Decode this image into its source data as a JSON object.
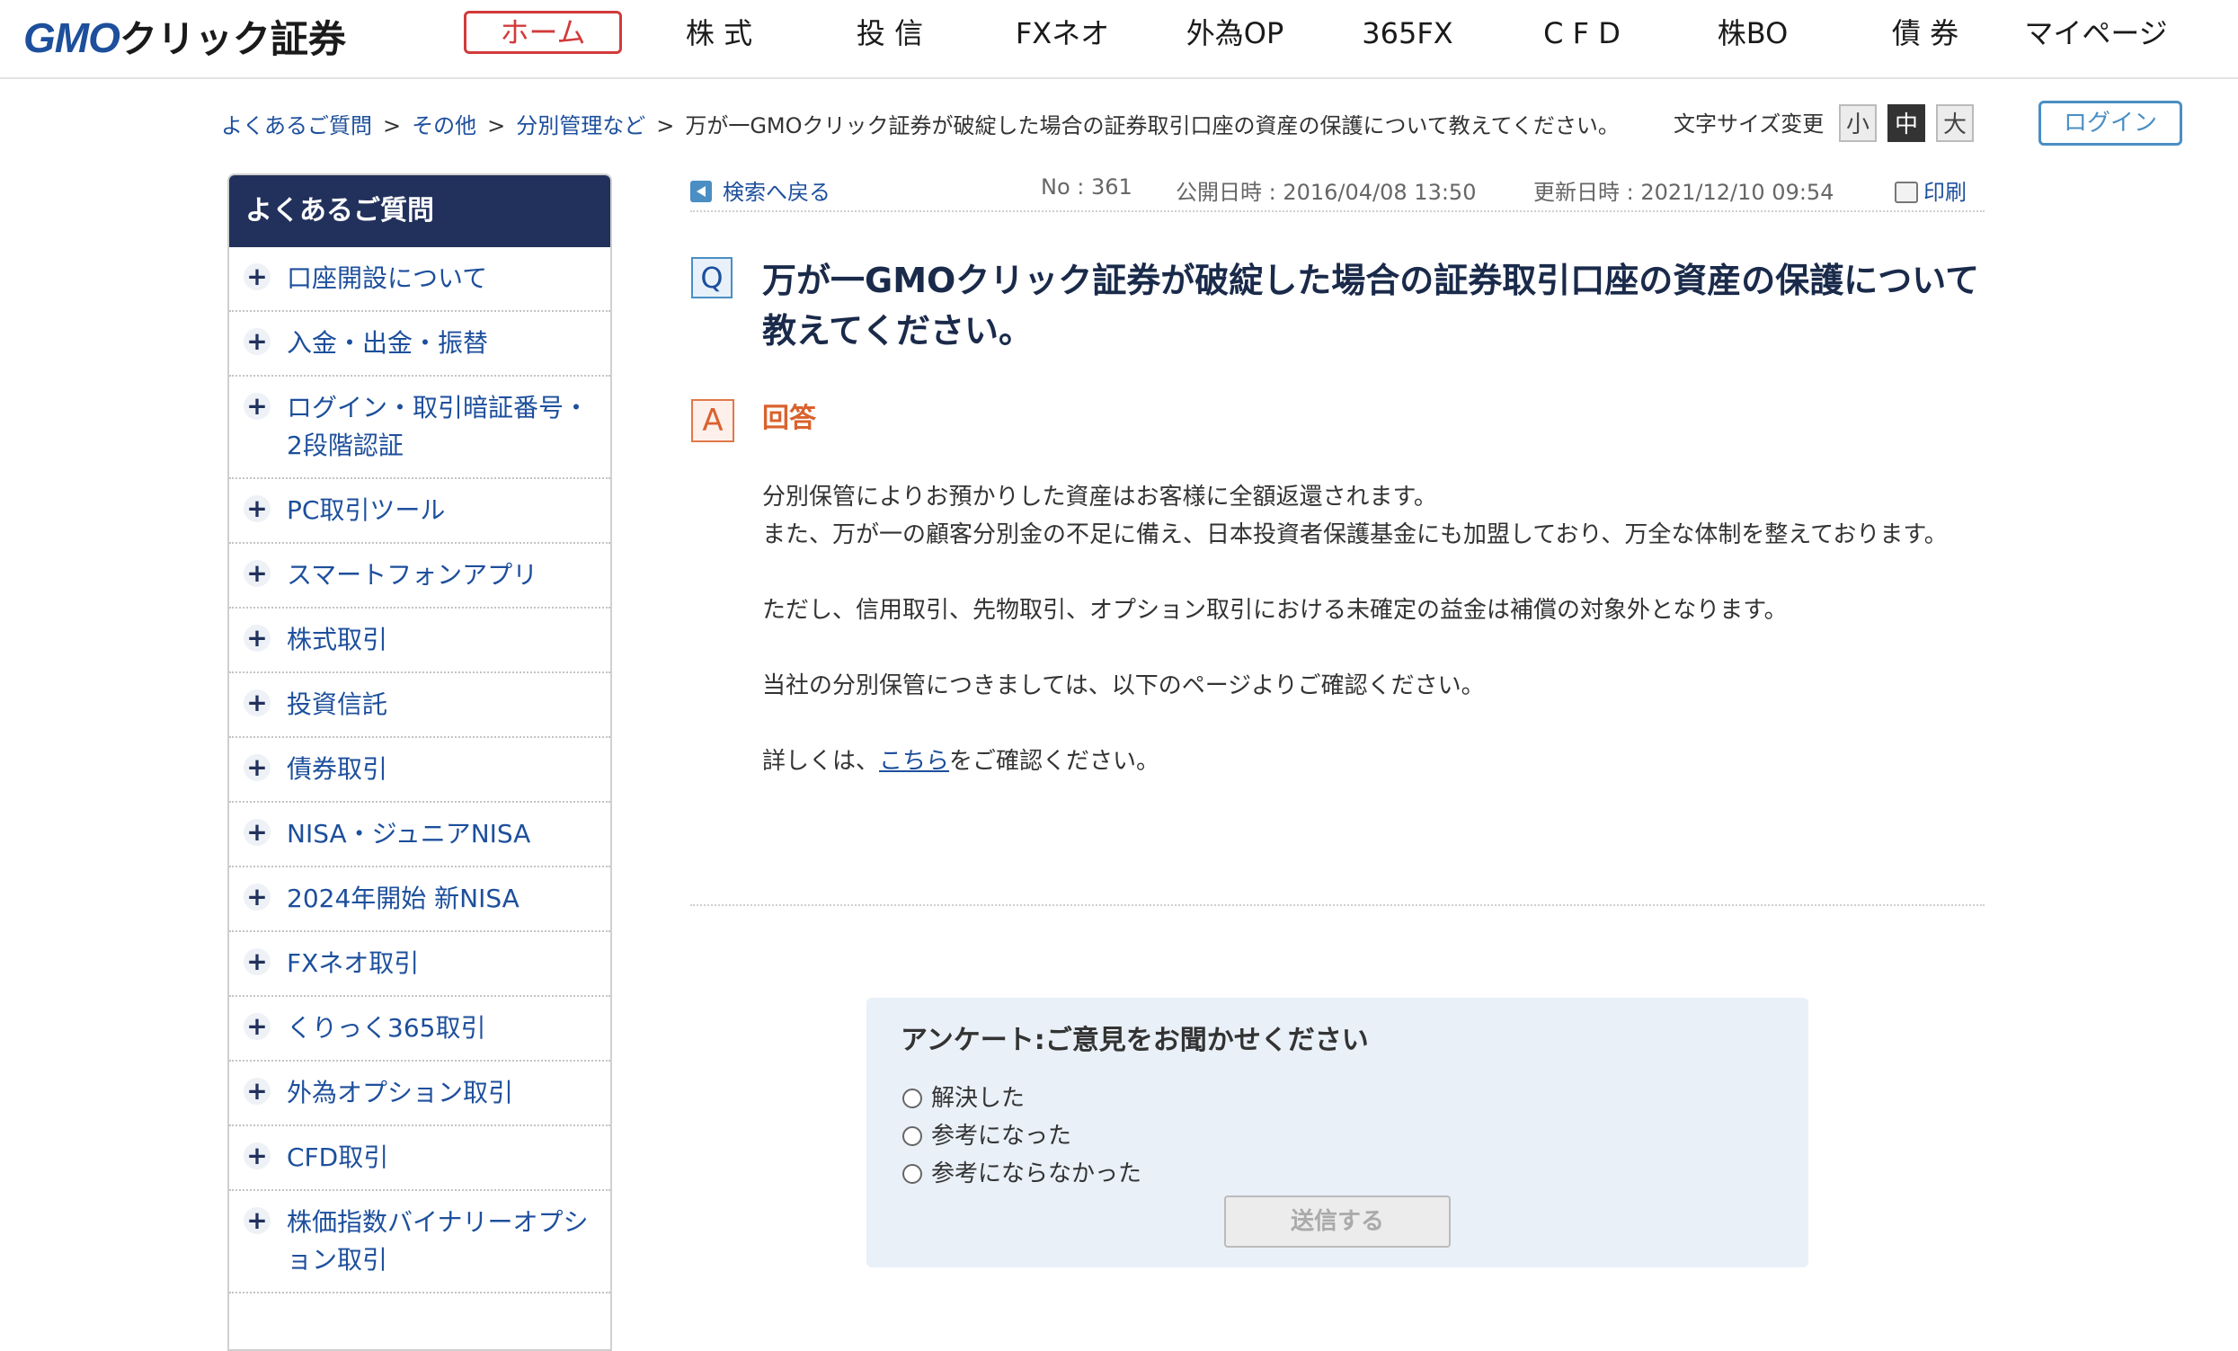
{
  "header": {
    "logo_gmo": "GMO",
    "logo_rest": "クリック証券",
    "nav": [
      "ホーム",
      "株 式",
      "投 信",
      "FXネオ",
      "外為OP",
      "365FX",
      "C F D",
      "株BO",
      "債 券",
      "マイページ"
    ]
  },
  "breadcrumb": {
    "items": [
      "よくあるご質問",
      "その他",
      "分別管理など"
    ],
    "separator": ">",
    "current": "万が一GMOクリック証券が破綻した場合の証券取引口座の資産の保護について教えてください。"
  },
  "font_size": {
    "label": "文字サイズ変更",
    "options": [
      "小",
      "中",
      "大"
    ],
    "selected": "中"
  },
  "login_label": "ログイン",
  "sidebar": {
    "heading": "よくあるご質問",
    "items": [
      "口座開設について",
      "入金・出金・振替",
      "ログイン・取引暗証番号・2段階認証",
      "PC取引ツール",
      "スマートフォンアプリ",
      "株式取引",
      "投資信託",
      "債券取引",
      "NISA・ジュニアNISA",
      "2024年開始 新NISA",
      "FXネオ取引",
      "くりっく365取引",
      "外為オプション取引",
      "CFD取引",
      "株価指数バイナリーオプション取引"
    ]
  },
  "article": {
    "back_label": "検索へ戻る",
    "number": "No : 361",
    "published": "公開日時 : 2016/04/08 13:50",
    "updated": "更新日時 : 2021/12/10 09:54",
    "print_label": "印刷",
    "q_badge": "Q",
    "question": "万が一GMOクリック証券が破綻した場合の証券取引口座の資産の保護について教えてください。",
    "a_badge": "A",
    "answer_label": "回答",
    "answer_line1": "分別保管によりお預かりした資産はお客様に全額返還されます。",
    "answer_line2": "また、万が一の顧客分別金の不足に備え、日本投資者保護基金にも加盟しており、万全な体制を整えております。",
    "answer_line3": "ただし、信用取引、先物取引、オプション取引における未確定の益金は補償の対象外となります。",
    "answer_line4": "当社の分別保管につきましては、以下のページよりご確認ください。",
    "answer_line5_prefix": "詳しくは、",
    "answer_link": "こちら",
    "answer_line5_suffix": "をご確認ください。"
  },
  "survey": {
    "title": "アンケート:ご意見をお聞かせください",
    "options": [
      "解決した",
      "参考になった",
      "参考にならなかった"
    ],
    "submit_label": "送信する"
  }
}
